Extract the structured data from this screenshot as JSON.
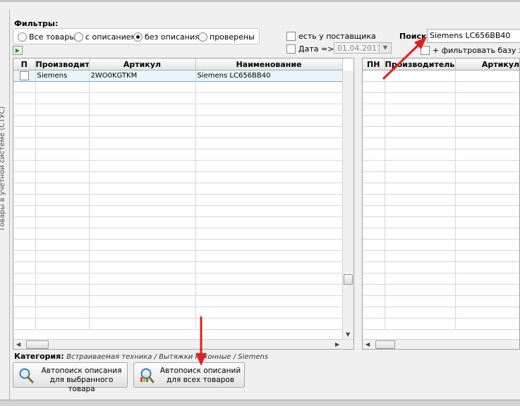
{
  "side_label": "Товары в учетной системе (СТУС)",
  "filters": {
    "title": "Фильтры:",
    "options": [
      {
        "label": "Все товары",
        "selected": false
      },
      {
        "label": "с описанием",
        "selected": false
      },
      {
        "label": "без описания",
        "selected": true
      },
      {
        "label": "проверены",
        "selected": false
      }
    ]
  },
  "checks": {
    "supplier": "есть у поставщика",
    "date": "Дата =>",
    "date_value": "01.04.2017",
    "filter_base": "+ фильтровать базу зна"
  },
  "search": {
    "label": "Поиск:",
    "value": "Siemens LC656BB40"
  },
  "left_grid": {
    "columns": [
      "П",
      "Производите",
      "Артикул",
      "Наименование"
    ],
    "rows": [
      {
        "maker": "Siemens",
        "article": "2WO0KGTKM",
        "name": "Siemens LC656BB40"
      }
    ]
  },
  "right_grid": {
    "columns": [
      "ПН",
      "Производитель",
      "Артикул"
    ]
  },
  "category": {
    "label": "Категория:",
    "value": "Встраиваемая техника / Вытяжки кухонные / Siemens"
  },
  "buttons": {
    "selected": "Автопоиск описания\nдля выбранного товара",
    "selected_l1": "Автопоиск описания",
    "selected_l2": "для выбранного товара",
    "all_l1": "Автопоиск описаний",
    "all_l2": "для всех товаров"
  }
}
